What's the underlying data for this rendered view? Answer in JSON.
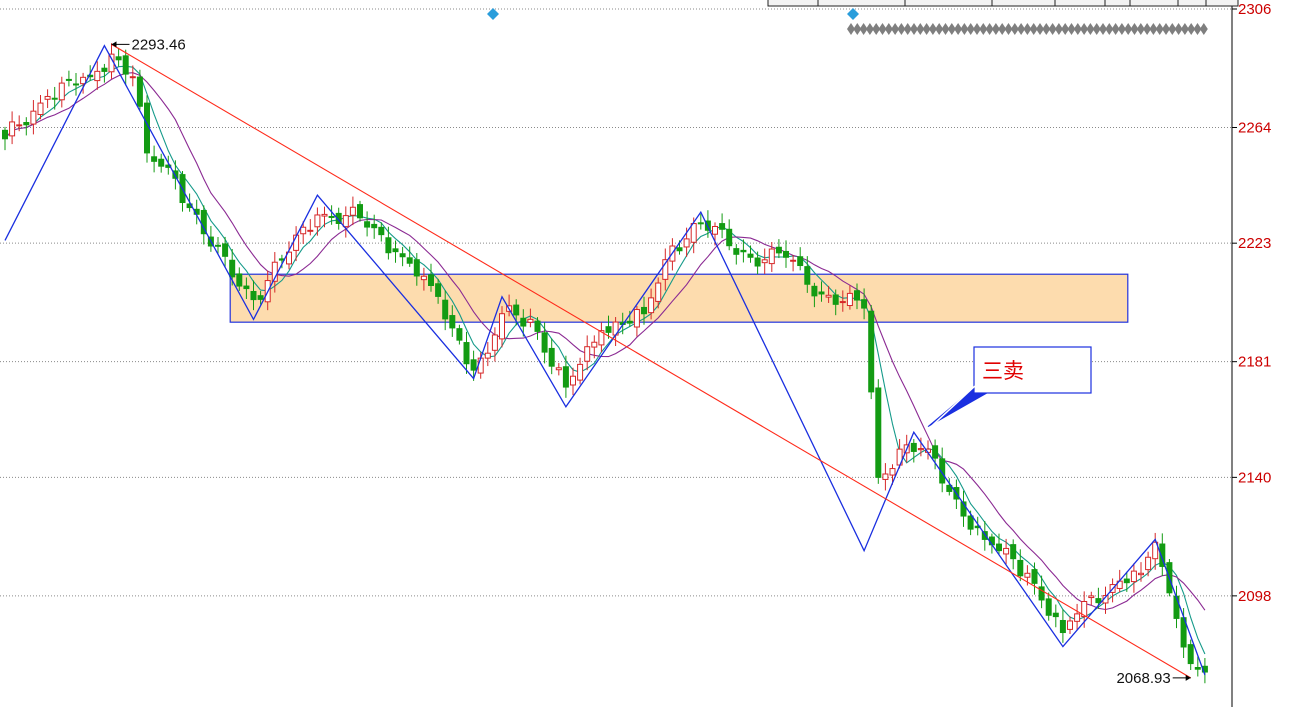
{
  "chart_data": {
    "type": "candlestick",
    "ylim": [
      2060,
      2308
    ],
    "y_ticks": [
      2306,
      2264,
      2223,
      2181,
      2140,
      2098
    ],
    "high_marker": {
      "value": "2293.46",
      "index": 15
    },
    "low_marker": {
      "value": "2068.93",
      "index": 167
    },
    "callout": {
      "text": "三卖",
      "index": 130
    },
    "zone": {
      "from_index": 32,
      "to_index": 158,
      "low": 2195,
      "high": 2212
    },
    "trendline": {
      "from": {
        "index": 15,
        "value": 2293.46
      },
      "to": {
        "index": 167,
        "value": 2068.93
      }
    },
    "zigzag": [
      {
        "index": 0,
        "value": 2224
      },
      {
        "index": 14,
        "value": 2293
      },
      {
        "index": 35,
        "value": 2196
      },
      {
        "index": 44,
        "value": 2240
      },
      {
        "index": 66,
        "value": 2175
      },
      {
        "index": 70,
        "value": 2204
      },
      {
        "index": 79,
        "value": 2165
      },
      {
        "index": 98,
        "value": 2234
      },
      {
        "index": 121,
        "value": 2114
      },
      {
        "index": 128,
        "value": 2156
      },
      {
        "index": 149,
        "value": 2080
      },
      {
        "index": 162,
        "value": 2118
      },
      {
        "index": 169,
        "value": 2070
      }
    ],
    "candle_keypoints": [
      {
        "index": 0,
        "close": 2260
      },
      {
        "index": 6,
        "close": 2275
      },
      {
        "index": 12,
        "close": 2282
      },
      {
        "index": 15,
        "close": 2290
      },
      {
        "index": 18,
        "close": 2282
      },
      {
        "index": 20,
        "close": 2255
      },
      {
        "index": 24,
        "close": 2246
      },
      {
        "index": 29,
        "close": 2222
      },
      {
        "index": 35,
        "close": 2203
      },
      {
        "index": 39,
        "close": 2217
      },
      {
        "index": 44,
        "close": 2233
      },
      {
        "index": 50,
        "close": 2232
      },
      {
        "index": 55,
        "close": 2220
      },
      {
        "index": 60,
        "close": 2208
      },
      {
        "index": 66,
        "close": 2178
      },
      {
        "index": 68,
        "close": 2184
      },
      {
        "index": 70,
        "close": 2198
      },
      {
        "index": 74,
        "close": 2196
      },
      {
        "index": 79,
        "close": 2172
      },
      {
        "index": 84,
        "close": 2192
      },
      {
        "index": 90,
        "close": 2198
      },
      {
        "index": 94,
        "close": 2222
      },
      {
        "index": 98,
        "close": 2230
      },
      {
        "index": 105,
        "close": 2218
      },
      {
        "index": 110,
        "close": 2218
      },
      {
        "index": 115,
        "close": 2205
      },
      {
        "index": 121,
        "close": 2200
      },
      {
        "index": 123,
        "close": 2140
      },
      {
        "index": 126,
        "close": 2150
      },
      {
        "index": 130,
        "close": 2150
      },
      {
        "index": 133,
        "close": 2135
      },
      {
        "index": 138,
        "close": 2118
      },
      {
        "index": 144,
        "close": 2106
      },
      {
        "index": 149,
        "close": 2085
      },
      {
        "index": 152,
        "close": 2096
      },
      {
        "index": 156,
        "close": 2102
      },
      {
        "index": 160,
        "close": 2106
      },
      {
        "index": 162,
        "close": 2117
      },
      {
        "index": 165,
        "close": 2090
      },
      {
        "index": 167,
        "close": 2074
      },
      {
        "index": 168,
        "close": 2072
      },
      {
        "index": 169,
        "close": 2071
      }
    ],
    "colors": {
      "up": "#d62728",
      "down": "#139b13",
      "ma_fast": "#159a8a",
      "ma_slow": "#8b2a93",
      "zigzag": "#1a2fe0",
      "trendline": "#ff2a1a",
      "zone_fill": "#fddcae",
      "zone_border": "#2233dd",
      "grid": "#8a8a8a",
      "axis_text": "#cc0000",
      "marker": "#2a9ddb"
    },
    "top_markers": [
      "diamond",
      "diamond"
    ],
    "grid": true
  }
}
